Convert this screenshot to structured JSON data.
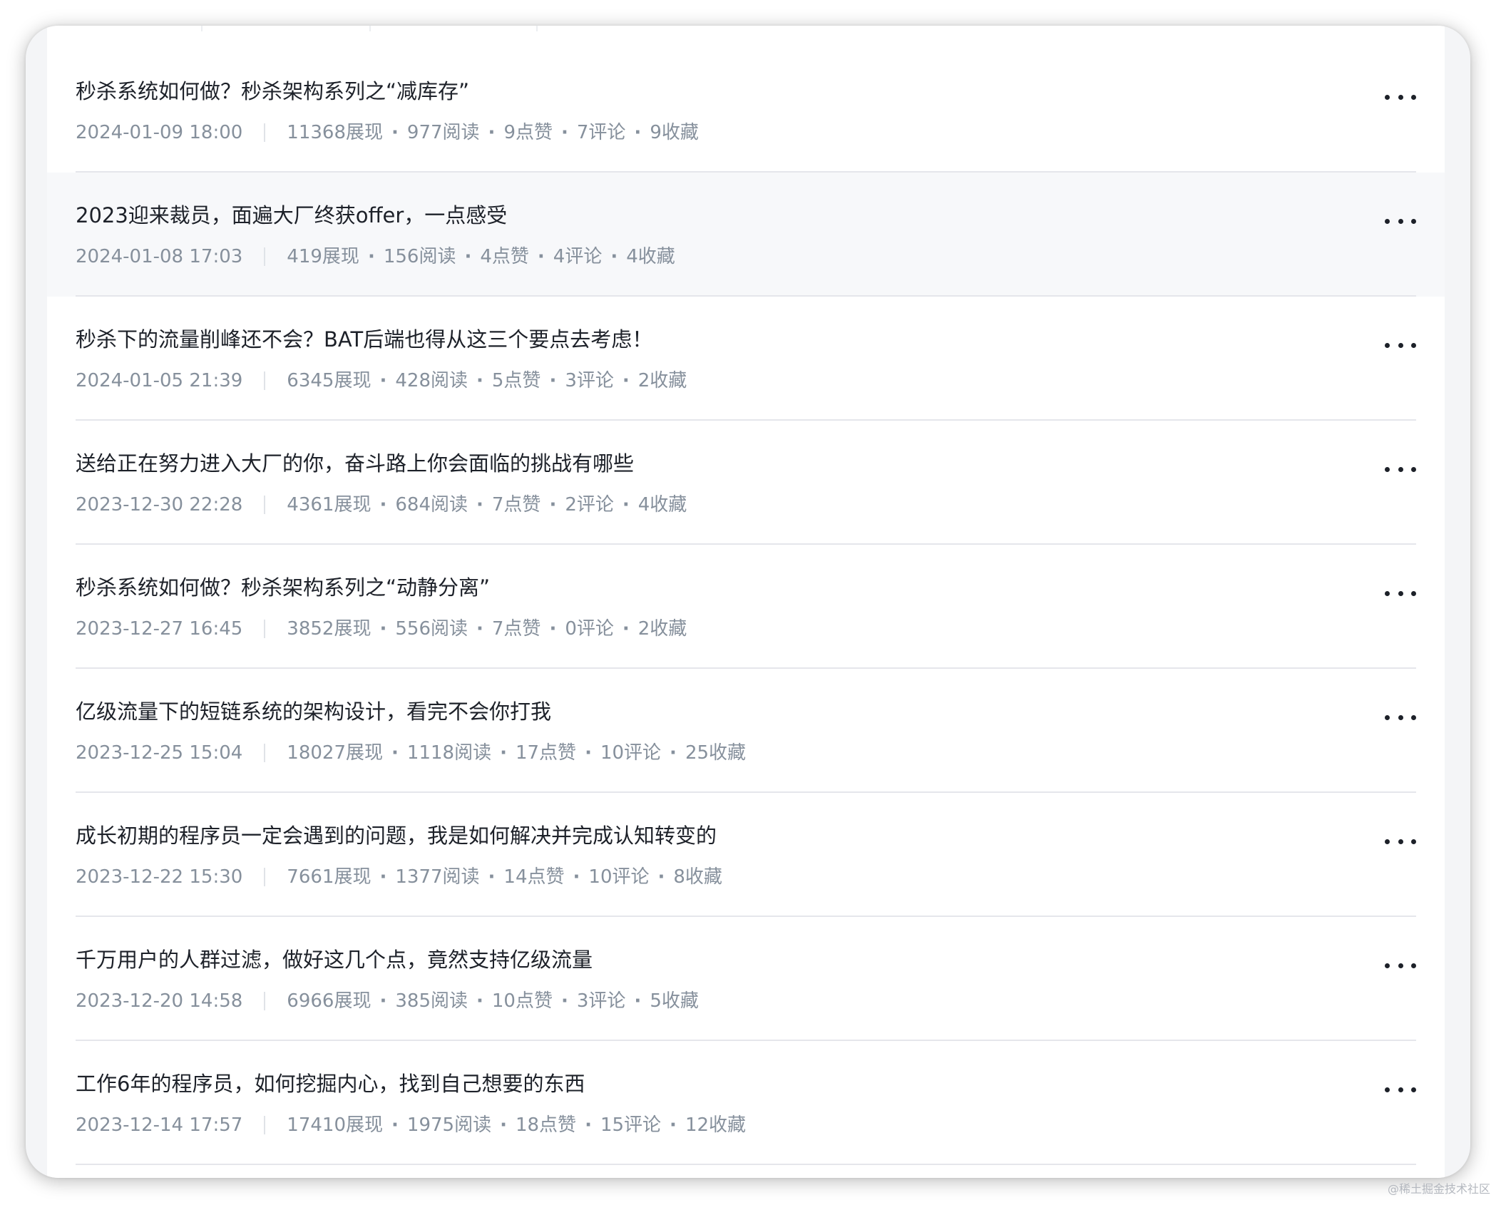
{
  "articles": [
    {
      "title": "秒杀系统如何做？秒杀架构系列之“减库存”",
      "date": "2024-01-09 18:00",
      "views": "11368展现",
      "reads": "977阅读",
      "likes": "9点赞",
      "comments": "7评论",
      "favorites": "9收藏"
    },
    {
      "title": "2023迎来裁员，面遍大厂终获offer，一点感受",
      "date": "2024-01-08 17:03",
      "views": "419展现",
      "reads": "156阅读",
      "likes": "4点赞",
      "comments": "4评论",
      "favorites": "4收藏"
    },
    {
      "title": "秒杀下的流量削峰还不会？BAT后端也得从这三个要点去考虑！",
      "date": "2024-01-05 21:39",
      "views": "6345展现",
      "reads": "428阅读",
      "likes": "5点赞",
      "comments": "3评论",
      "favorites": "2收藏"
    },
    {
      "title": "送给正在努力进入大厂的你，奋斗路上你会面临的挑战有哪些",
      "date": "2023-12-30 22:28",
      "views": "4361展现",
      "reads": "684阅读",
      "likes": "7点赞",
      "comments": "2评论",
      "favorites": "4收藏"
    },
    {
      "title": "秒杀系统如何做？秒杀架构系列之“动静分离”",
      "date": "2023-12-27 16:45",
      "views": "3852展现",
      "reads": "556阅读",
      "likes": "7点赞",
      "comments": "0评论",
      "favorites": "2收藏"
    },
    {
      "title": "亿级流量下的短链系统的架构设计，看完不会你打我",
      "date": "2023-12-25 15:04",
      "views": "18027展现",
      "reads": "1118阅读",
      "likes": "17点赞",
      "comments": "10评论",
      "favorites": "25收藏"
    },
    {
      "title": "成长初期的程序员一定会遇到的问题，我是如何解决并完成认知转变的",
      "date": "2023-12-22 15:30",
      "views": "7661展现",
      "reads": "1377阅读",
      "likes": "14点赞",
      "comments": "10评论",
      "favorites": "8收藏"
    },
    {
      "title": "千万用户的人群过滤，做好这几个点，竟然支持亿级流量",
      "date": "2023-12-20 14:58",
      "views": "6966展现",
      "reads": "385阅读",
      "likes": "10点赞",
      "comments": "3评论",
      "favorites": "5收藏"
    },
    {
      "title": "工作6年的程序员，如何挖掘内心，找到自己想要的东西",
      "date": "2023-12-14 17:57",
      "views": "17410展现",
      "reads": "1975阅读",
      "likes": "18点赞",
      "comments": "15评论",
      "favorites": "12收藏"
    }
  ],
  "separators": {
    "dot": "·"
  },
  "icons": {
    "more": "more-horizontal-icon"
  },
  "watermark": "@稀土掘金技术社区"
}
